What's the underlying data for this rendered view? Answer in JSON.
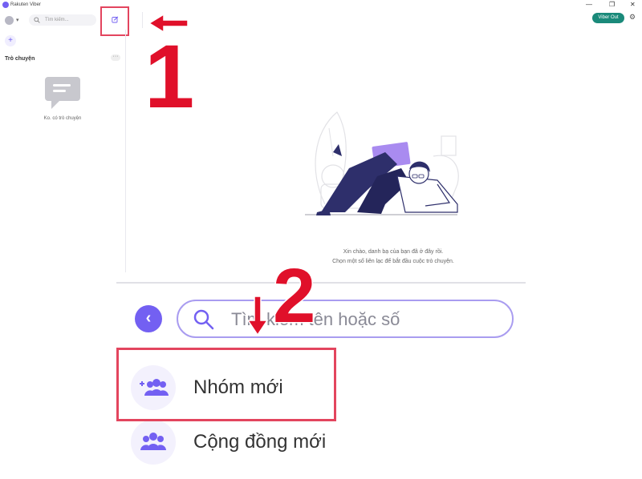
{
  "window": {
    "title": "Rakuten Viber",
    "controls": {
      "minimize": "—",
      "maximize": "❐",
      "close": "✕"
    }
  },
  "toolbar": {
    "search_placeholder": "Tìm kiếm...",
    "viber_out_label": "Viber Out",
    "compose_icon": "compose-icon",
    "settings_icon": "gear-icon"
  },
  "sidebar": {
    "add_label": "+",
    "chats_heading": "Trò chuyện",
    "more_label": "···",
    "empty_text": "Ko. có trò chuyện"
  },
  "main": {
    "welcome_line1": "Xin chào, danh bạ của bạn đã ở đây rồi.",
    "welcome_line2": "Chọn một số liên lạc để bắt đầu cuộc trò chuyện."
  },
  "zoomed": {
    "search_placeholder": "Tìm kiếm tên hoặc số",
    "items": [
      {
        "label": "Nhóm mới",
        "icon": "add-group-icon"
      },
      {
        "label": "Cộng đồng mới",
        "icon": "community-icon"
      }
    ]
  },
  "annotations": {
    "step1": "1",
    "step2": "2",
    "highlight_color": "#e3455e",
    "number_color": "#e0102a"
  },
  "colors": {
    "accent": "#7360f2",
    "viber_out": "#1a8a7a",
    "illustration_dark": "#2e2f6b"
  }
}
